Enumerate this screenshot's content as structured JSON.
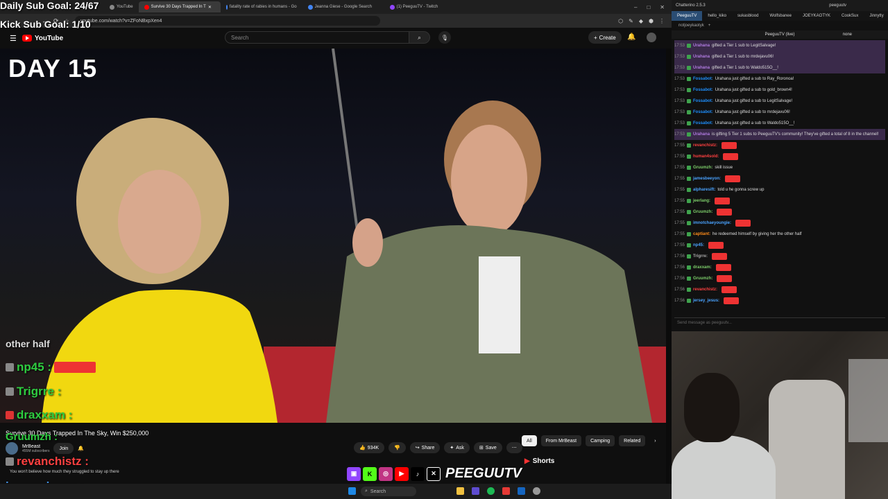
{
  "stream_overlay": {
    "sub_goal": "Daily Sub Goal: 24/67",
    "kick_goal": "Kick Sub Goal: 1/10",
    "chat": [
      {
        "user": "other half",
        "suffix": ""
      },
      {
        "user": "np45 :",
        "suffix": ""
      },
      {
        "user": "Trigrre :",
        "suffix": ""
      },
      {
        "user": "draxxam :",
        "suffix": ""
      },
      {
        "user": "Gruumzh :",
        "suffix": ""
      },
      {
        "user": "revanchistz :",
        "suffix": ""
      },
      {
        "user": "jersey_jesus :",
        "suffix": ""
      }
    ],
    "brand_name": "PEEGUUTV"
  },
  "browser": {
    "tabs": [
      {
        "label": "YouTube",
        "color": "#888888"
      },
      {
        "label": "Survive 30 Days Trapped In T",
        "color": "#ff0000",
        "active": true
      },
      {
        "label": "fatality rate of rabies in humans - Go",
        "color": "#4285f4"
      },
      {
        "label": "Jeanna Giese - Google Search",
        "color": "#4285f4"
      },
      {
        "label": "(1) PeeguuTV - Twitch",
        "color": "#9146ff"
      }
    ],
    "url": "youtube.com/watch?v=ZFoNBxpXen4"
  },
  "youtube": {
    "logo": "YouTube",
    "search_placeholder": "Search",
    "create_label": "Create",
    "video_overlay_text": "DAY 15",
    "title": "Survive 30 Days Trapped In The Sky, Win $250,000",
    "channel": "MrBeast",
    "subscribers": "455M subscribers",
    "join_label": "Join",
    "likes": "934K",
    "share_label": "Share",
    "ask_label": "Ask",
    "save_label": "Save",
    "chips": [
      "All",
      "From MrBeast",
      "Camping",
      "Related"
    ],
    "shorts_label": "Shorts",
    "description": "You won't believe how much they struggled to stay up there"
  },
  "taskbar": {
    "search_placeholder": "Search"
  },
  "chatterino": {
    "title": "Chatterino 2.5.3",
    "account": "peeguutv",
    "tabs": [
      "PeeguuTV",
      "hello_kiko",
      "sukasblood",
      "Wolfsbanee",
      "JOEYKAOTYK",
      "CookSux",
      "Jinnytty"
    ],
    "sub_tab": "notjoeykaotyk",
    "channel_header": "PeeguuTV (live)",
    "channel_mode": "none",
    "lines": [
      {
        "time": "17:53",
        "user": "Urahana",
        "text": "gifted a Tier 1 sub to LegitSalvage!",
        "hl": true,
        "color": "#b07be0"
      },
      {
        "time": "17:53",
        "user": "Urahana",
        "text": "gifted a Tier 1 sub to mrdejavu06!",
        "hl": true,
        "color": "#b07be0"
      },
      {
        "time": "17:53",
        "user": "Urahana",
        "text": "gifted a Tier 1 sub to Waldo515O__!",
        "hl": true,
        "color": "#b07be0"
      },
      {
        "time": "17:53",
        "user": "Fossabot:",
        "text": "Urahana just gifted a sub to Ray_Roronoa!",
        "hl": false,
        "color": "#1e90ff"
      },
      {
        "time": "17:53",
        "user": "Fossabot:",
        "text": "Urahana just gifted a sub to gold_brown4!",
        "hl": false,
        "color": "#1e90ff"
      },
      {
        "time": "17:53",
        "user": "Fossabot:",
        "text": "Urahana just gifted a sub to LegitSalvage!",
        "hl": false,
        "color": "#1e90ff"
      },
      {
        "time": "17:53",
        "user": "Fossabot:",
        "text": "Urahana just gifted a sub to mrdejavu06!",
        "hl": false,
        "color": "#1e90ff"
      },
      {
        "time": "17:53",
        "user": "Fossabot:",
        "text": "Urahana just gifted a sub to Waldo515O__!",
        "hl": false,
        "color": "#1e90ff"
      },
      {
        "time": "17:53",
        "user": "Urahana",
        "text": "is gifting 5 Tier 1 subs to PeeguuTV's community! They've gifted a total of 8 in the channel!",
        "hl": true,
        "color": "#b07be0"
      },
      {
        "time": "17:55",
        "user": "revanchistz:",
        "text": "",
        "hl": false,
        "color": "#ff4040"
      },
      {
        "time": "17:55",
        "user": "human4sold:",
        "text": "",
        "hl": false,
        "color": "#ff4040"
      },
      {
        "time": "17:55",
        "user": "Gruumzh:",
        "text": "skill issue",
        "hl": false,
        "color": "#7ecf6b"
      },
      {
        "time": "17:55",
        "user": "jamesbeeyon:",
        "text": "",
        "hl": false,
        "color": "#4aa3ff"
      },
      {
        "time": "17:55",
        "user": "alpharesift:",
        "text": "told u he gonna screw up",
        "hl": false,
        "color": "#4aa3ff"
      },
      {
        "time": "17:55",
        "user": "jeerlang:",
        "text": "",
        "hl": false,
        "color": "#7ecf6b"
      },
      {
        "time": "17:55",
        "user": "Gruumzh:",
        "text": "",
        "hl": false,
        "color": "#7ecf6b"
      },
      {
        "time": "17:55",
        "user": "imnotchaeyoungie:",
        "text": "",
        "hl": false,
        "color": "#4aa3ff"
      },
      {
        "time": "17:55",
        "user": "captiant:",
        "text": "he redeemed himself by giving her the other half",
        "hl": false,
        "color": "#ff8c1a"
      },
      {
        "time": "17:55",
        "user": "np45:",
        "text": "",
        "hl": false,
        "color": "#4aa3ff"
      },
      {
        "time": "17:56",
        "user": "Trigrre:",
        "text": "",
        "hl": false,
        "color": "#aaaaaa"
      },
      {
        "time": "17:56",
        "user": "draxxam:",
        "text": "",
        "hl": false,
        "color": "#7ecf6b"
      },
      {
        "time": "17:56",
        "user": "Gruumzh:",
        "text": "",
        "hl": false,
        "color": "#7ecf6b"
      },
      {
        "time": "17:56",
        "user": "revanchistz:",
        "text": "",
        "hl": false,
        "color": "#ff4040"
      },
      {
        "time": "17:56",
        "user": "jersey_jesus:",
        "text": "",
        "hl": false,
        "color": "#4aa3ff"
      }
    ],
    "input_placeholder": "Send message as peeguutv..."
  }
}
